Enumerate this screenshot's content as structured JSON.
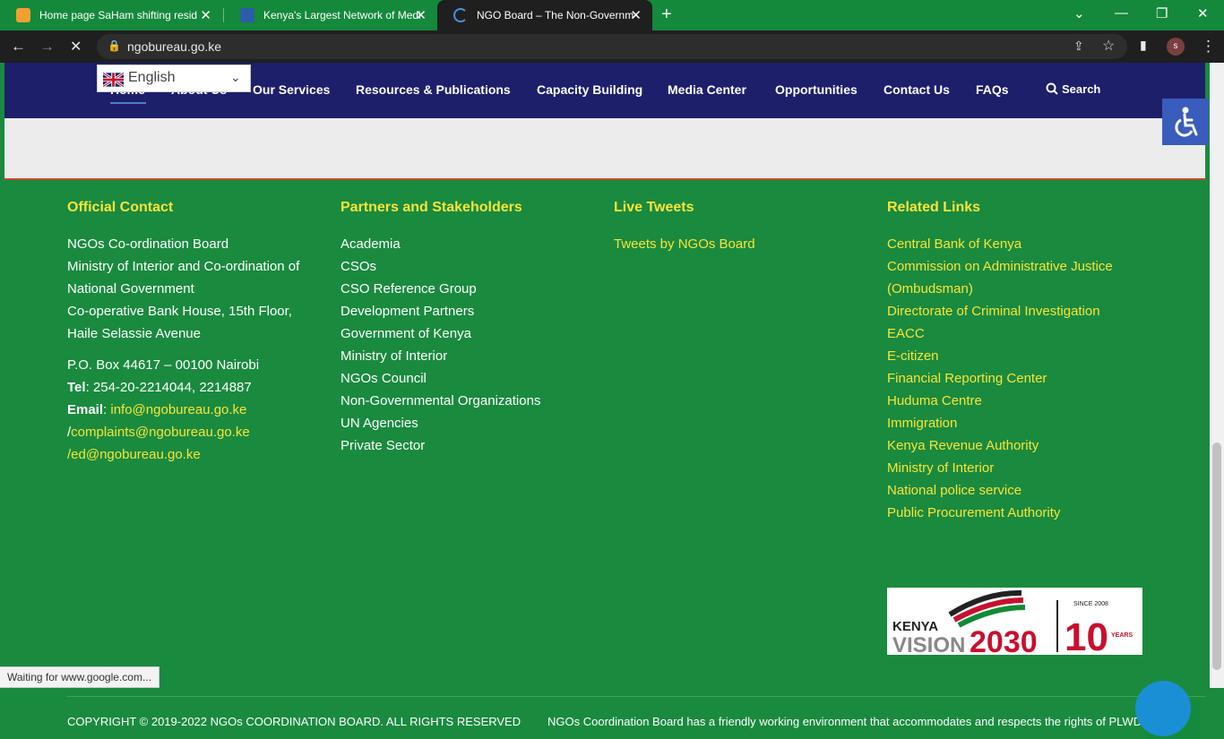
{
  "browser": {
    "tabs": [
      {
        "title": "Home page SaHam shifting resid",
        "active": false,
        "favicon_color": "#f0a030"
      },
      {
        "title": "Kenya's Largest Network of Medi",
        "active": false,
        "favicon_color": "#2d5da8"
      },
      {
        "title": "NGO Board – The Non-Governm",
        "active": true,
        "favicon_color": "#4a90e2"
      }
    ],
    "url": "ngobureau.go.ke",
    "profile_initial": "s",
    "status_text": "Waiting for www.google.com..."
  },
  "nav": {
    "items": [
      "Home",
      "About Us",
      "Our Services",
      "Resources & Publications",
      "Capacity Building",
      "Media Center",
      "Opportunities",
      "Contact Us",
      "FAQs"
    ],
    "search_label": "Search",
    "language": "English"
  },
  "footer": {
    "official_contact": {
      "heading": "Official Contact",
      "address_lines": [
        "NGOs Co-ordination Board",
        "Ministry of Interior and Co-ordination of",
        "National Government",
        "Co-operative Bank House, 15th Floor,",
        "Haile Selassie Avenue"
      ],
      "po_box": "P.O. Box 44617 – 00100 Nairobi",
      "tel_label": "Tel",
      "tel_value": ": 254-20-2214044, 2214887",
      "email_label": "Email",
      "email_value": "info@ngobureau.go.ke",
      "complaints": "complaints@ngobureau.go.ke",
      "ed": "/ed@ngobureau.go.ke"
    },
    "partners": {
      "heading": "Partners and Stakeholders",
      "items": [
        "Academia",
        "CSOs",
        "CSO Reference Group",
        "Development Partners",
        "Government of Kenya",
        "Ministry of Interior",
        "NGOs Council",
        "Non-Governmental Organizations",
        "UN Agencies",
        "Private Sector"
      ]
    },
    "tweets": {
      "heading": "Live Tweets",
      "link": "Tweets by NGOs Board"
    },
    "related": {
      "heading": "Related Links",
      "items": [
        "Central Bank of Kenya",
        "Commission on Administrative Justice",
        "(Ombudsman)",
        "Directorate of Criminal Investigation",
        "EACC",
        "E-citizen",
        "Financial Reporting Center",
        "Huduma Centre",
        "Immigration",
        "Kenya Revenue Authority",
        "Ministry of Interior",
        "National police service",
        "Public Procurement Authority"
      ]
    },
    "vision_logo": {
      "kenya": "KENYA",
      "vision": "VISION",
      "year": "2030",
      "since": "SINCE 2008",
      "ten": "10",
      "years": "YEARS"
    },
    "copyright": "COPYRIGHT © 2019-2022 NGOs COORDINATION BOARD. ALL RIGHTS RESERVED",
    "slogan": "NGOs Coordination Board has a friendly working environment that accommodates and respects the rights of PLWDs"
  },
  "colors": {
    "footer_green": "#1a8a3f",
    "nav_navy": "#1e1f6b",
    "accent_yellow": "#f7e43a",
    "chat_blue": "#1a8fd6"
  }
}
